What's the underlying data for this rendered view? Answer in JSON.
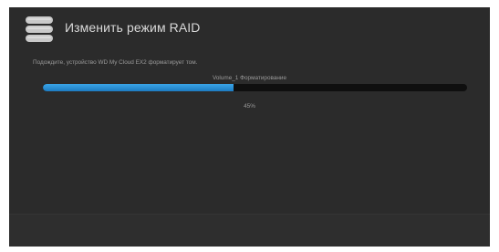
{
  "dialog": {
    "title": "Изменить режим RAID",
    "icon": "database-icon",
    "message": "Подождите, устройство WD My Cloud EX2 форматирует том.",
    "volume_label": "Volume_1 Форматирование",
    "progress_percent": 45,
    "progress_text": "45%"
  },
  "colors": {
    "dialog_background": "#2b2b2b",
    "progress_fill": "#2a8fd6",
    "progress_track": "#0f0f0f",
    "title_text": "#d8d8d8",
    "body_text": "#9a9a9a"
  }
}
